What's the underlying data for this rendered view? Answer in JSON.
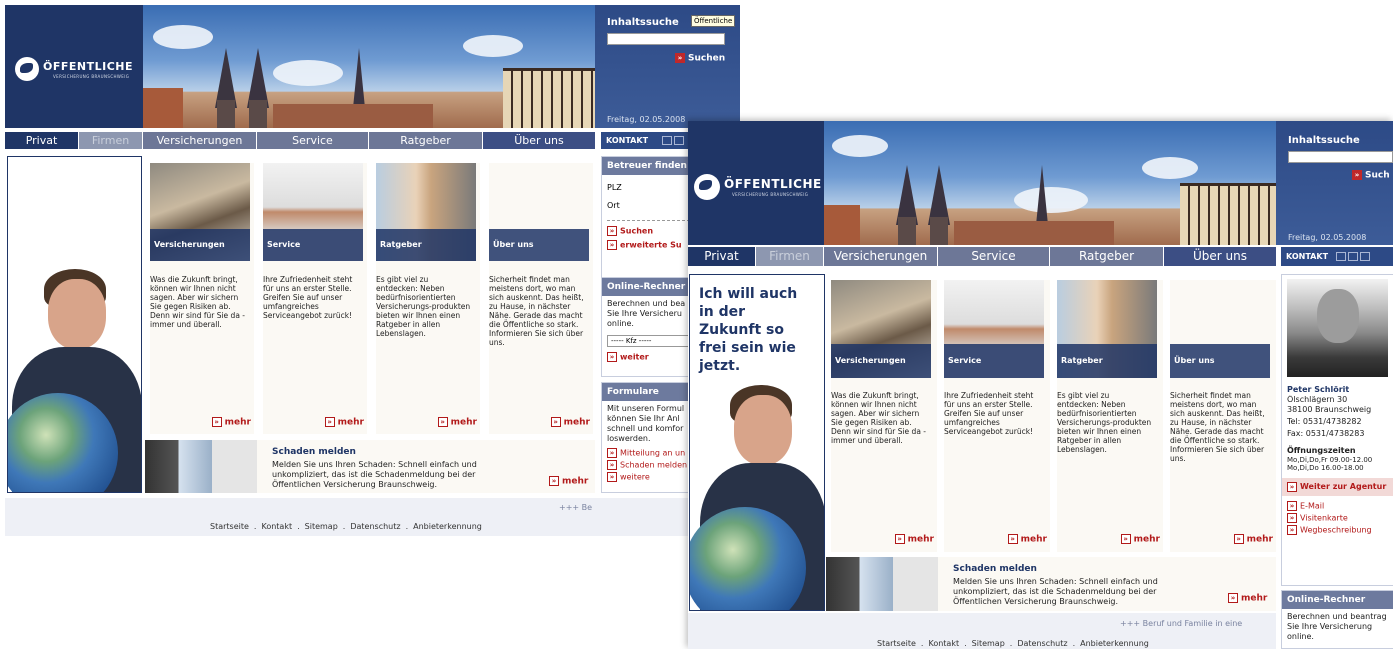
{
  "brand": {
    "name": "ÖFFENTLICHE",
    "sub": "VERSICHERUNG BRAUNSCHWEIG"
  },
  "search": {
    "label": "Inhaltssuche",
    "tooltip": "Öffentliche",
    "button": "Suchen",
    "button_short": "Such"
  },
  "date": "Freitag, 02.05.2008",
  "nav": [
    "Privat",
    "Firmen",
    "Versicherungen",
    "Service",
    "Ratgeber",
    "Über uns"
  ],
  "kontakt": "KONTAKT",
  "slogan": "Ich will auch in der Zukunft so frei sein wie jetzt.",
  "cards": [
    {
      "title": "Versicherungen",
      "text": "Was die Zukunft bringt, können wir Ihnen nicht sagen. Aber wir sichern Sie gegen Risiken ab. Denn wir sind für Sie da - immer und überall.",
      "more": "mehr"
    },
    {
      "title": "Service",
      "text": "Ihre Zufriedenheit steht für uns an erster Stelle. Greifen Sie auf unser umfangreiches Serviceangebot zurück!",
      "more": "mehr"
    },
    {
      "title": "Ratgeber",
      "text": "Es gibt viel zu entdecken: Neben bedürfnisorientierten Versicherungs-produkten bieten wir Ihnen einen Ratgeber in allen Lebenslagen.",
      "more": "mehr"
    },
    {
      "title": "Über uns",
      "text": "Sicherheit findet man meistens dort, wo man sich auskennt. Das heißt, zu Hause, in nächster Nähe. Gerade das macht die Öffentliche so stark. Informieren Sie sich über uns.",
      "more": "mehr"
    }
  ],
  "schaden": {
    "title": "Schaden melden",
    "text": "Melden Sie uns Ihren Schaden: Schnell einfach und unkompliziert, das ist die Schadenmeldung bei der Öffentlichen Versicherung Braunschweig.",
    "more": "mehr"
  },
  "ticker": {
    "s1": "+++ Be",
    "s2": "+++ Beruf und Familie in eine"
  },
  "footer": [
    "Startseite",
    "Kontakt",
    "Sitemap",
    "Datenschutz",
    "Anbieterkennung"
  ],
  "betreuer": {
    "title": "Betreuer finden!",
    "plz": "PLZ",
    "ort": "Ort",
    "suchen": "Suchen",
    "erweitert": "erweiterte Su"
  },
  "rechner1": {
    "title": "Online-Rechner",
    "text": [
      "Berechnen und bea",
      "Sie Ihre Versicheru",
      "online."
    ],
    "select": "----- Kfz -----",
    "weiter": "weiter"
  },
  "formulare": {
    "title": "Formulare",
    "text": [
      "Mit unseren Formul",
      "können Sie Ihr Anl",
      "schnell und komfor",
      "loswerden."
    ],
    "links": [
      "Mitteilung an un",
      "Schaden melden",
      "weitere"
    ]
  },
  "agent": {
    "name": "Peter Schlörit",
    "street": "Ölschlägern 30",
    "city": "38100 Braunschweig",
    "tel": "Tel: 0531/4738282",
    "fax": "Fax: 0531/4738283",
    "hours_title": "Öffnungszeiten",
    "hours": [
      "Mo,Di,Do,Fr 09.00-12.00",
      "Mo,Di,Do 16.00-18.00"
    ],
    "agentur": "Weiter zur Agentur",
    "links": [
      "E-Mail",
      "Visitenkarte",
      "Wegbeschreibung"
    ]
  },
  "rechner2": {
    "title": "Online-Rechner",
    "text": [
      "Berechnen und beantrag",
      "Sie Ihre Versicherung",
      "online."
    ]
  }
}
